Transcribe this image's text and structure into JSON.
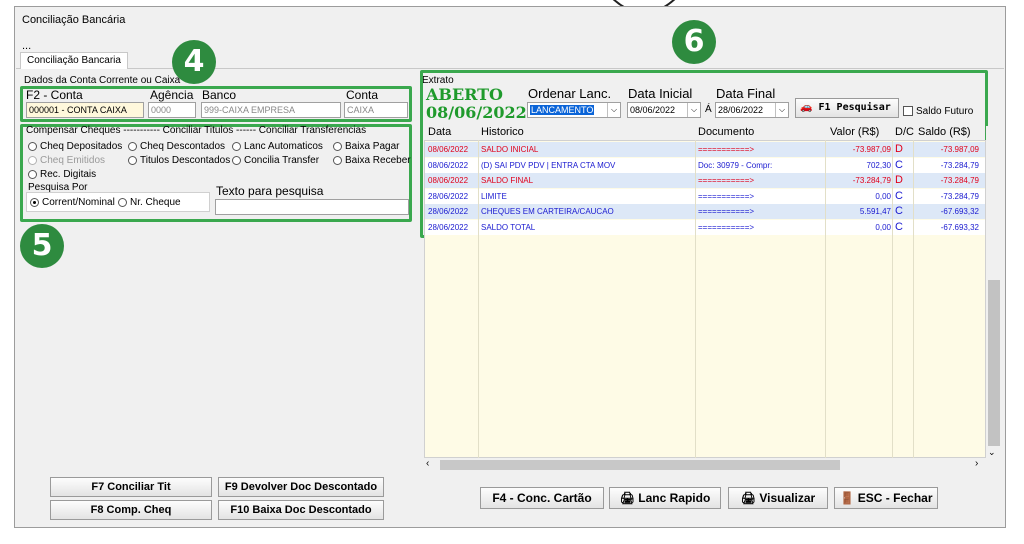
{
  "window": {
    "title": "Conciliação Bancária",
    "menu_ellipsis": "..."
  },
  "tab": {
    "label": "Conciliação Bancaria"
  },
  "badges": {
    "b4": "4",
    "b5": "5",
    "b6": "6"
  },
  "account": {
    "group_label": "Dados da Conta Corrente ou Caixa",
    "conta_label": "F2 - Conta",
    "agencia_label": "Agência",
    "banco_label": "Banco",
    "conta2_label": "Conta",
    "conta_value": "000001 - CONTA CAIXA",
    "agencia_value": "0000",
    "banco_value": "999-CAIXA EMPRESA",
    "conta2_value": "CAIXA"
  },
  "options": {
    "header": "Compensar Cheques ----------- Conciliar Titulos ------ Conciliar Transferencias",
    "radios": [
      {
        "label": "Cheq Depositados",
        "selected": false,
        "enabled": true
      },
      {
        "label": "Cheq Descontados",
        "selected": false,
        "enabled": true
      },
      {
        "label": "Lanc Automaticos",
        "selected": false,
        "enabled": true
      },
      {
        "label": "Baixa Pagar",
        "selected": false,
        "enabled": true
      },
      {
        "label": "Cheq Emitidos",
        "selected": false,
        "enabled": false
      },
      {
        "label": "Titulos Descontados",
        "selected": false,
        "enabled": true
      },
      {
        "label": "Concilia Transfer",
        "selected": false,
        "enabled": true
      },
      {
        "label": "Baixa Receber",
        "selected": false,
        "enabled": true
      },
      {
        "label": "Rec. Digitais",
        "selected": false,
        "enabled": true
      }
    ],
    "pesquisa_label": "Pesquisa Por",
    "pesquisa_radios": [
      {
        "label": "Corrent/Nominal",
        "selected": true
      },
      {
        "label": "Nr. Cheque",
        "selected": false
      }
    ],
    "texto_label": "Texto para pesquisa",
    "texto_value": ""
  },
  "left_buttons": {
    "conciliar": "F7 Conciliar Tit",
    "devolver": "F9 Devolver Doc Descontado",
    "comp": "F8 Comp. Cheq",
    "baixa": "F10 Baixa Doc Descontado"
  },
  "extrato": {
    "group_label": "Extrato",
    "status": "ABERTO",
    "date": "08/06/2022",
    "ordenar_label": "Ordenar Lanc.",
    "ordenar_value": "LANCAMENTO",
    "data_inicial_label": "Data Inicial",
    "data_inicial_value": "08/06/2022",
    "a_label": "Á",
    "data_final_label": "Data Final",
    "data_final_value": "28/06/2022",
    "pesquisar_label": "F1 Pesquisar",
    "saldo_futuro_label": "Saldo Futuro",
    "columns": [
      "Data",
      "Historico",
      "Documento",
      "Valor (R$)",
      "D/C",
      "Saldo (R$)",
      "C"
    ],
    "rows": [
      {
        "data": "08/06/2022",
        "historico": "SALDO INICIAL",
        "documento": "===========>",
        "valor": "-73.987,09",
        "dc": "D",
        "saldo": "-73.987,09",
        "color": "#e0001a",
        "bg": "#dde8f7"
      },
      {
        "data": "08/06/2022",
        "historico": "(D) SAI PDV PDV | ENTRA CTA MOV",
        "documento": "Doc: 30979 -  Compr:",
        "valor": "702,30",
        "dc": "C",
        "saldo": "-73.284,79",
        "color": "#1a1ad0",
        "bg": "#ffffff"
      },
      {
        "data": "08/06/2022",
        "historico": "SALDO FINAL",
        "documento": "===========>",
        "valor": "-73.284,79",
        "dc": "D",
        "saldo": "-73.284,79",
        "color": "#e0001a",
        "bg": "#dde8f7"
      },
      {
        "data": "28/06/2022",
        "historico": "LIMITE",
        "documento": "===========>",
        "valor": "0,00",
        "dc": "C",
        "saldo": "-73.284,79",
        "color": "#1a1ad0",
        "bg": "#ffffff"
      },
      {
        "data": "28/06/2022",
        "historico": "CHEQUES EM CARTEIRA/CAUCAO",
        "documento": "===========>",
        "valor": "5.591,47",
        "dc": "C",
        "saldo": "-67.693,32",
        "color": "#1a1ad0",
        "bg": "#dde8f7"
      },
      {
        "data": "28/06/2022",
        "historico": "SALDO TOTAL",
        "documento": "===========>",
        "valor": "0,00",
        "dc": "C",
        "saldo": "-67.693,32",
        "color": "#1a1ad0",
        "bg": "#ffffff"
      }
    ]
  },
  "right_buttons": {
    "conc_cartao": "F4 - Conc. Cartão",
    "lanc_rapido": "Lanc Rapido",
    "visualizar": "Visualizar",
    "fechar": "ESC - Fechar"
  },
  "colors": {
    "accent_green": "#3aa84e",
    "status_green": "#1f9a2c",
    "debit_red": "#e0001a",
    "credit_blue": "#1a1ad0"
  }
}
